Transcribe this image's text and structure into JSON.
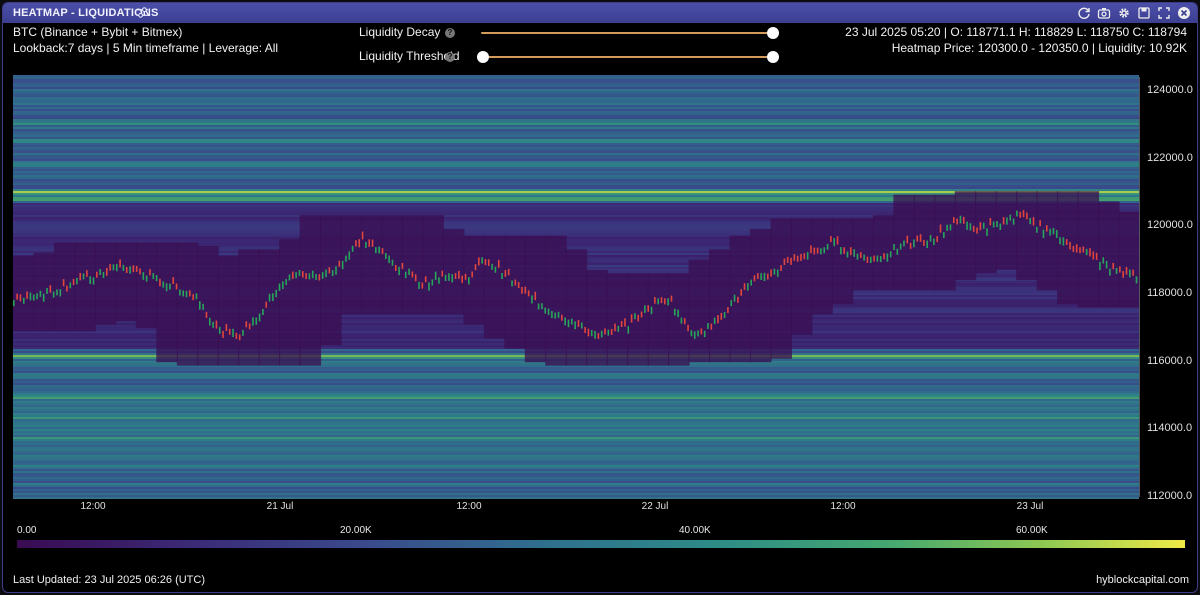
{
  "window": {
    "title": "HEATMAP - LIQUIDATIONS"
  },
  "colors": {
    "titlebar": "#3c3f91",
    "heat_low": "#3a0b53",
    "heat_high": "#f0ea47",
    "candle_up": "#26a65b",
    "candle_down": "#e0463c"
  },
  "toolbar_icons": [
    "refresh-icon",
    "camera-icon",
    "gear-icon",
    "save-icon",
    "expand-icon",
    "close-icon"
  ],
  "info": {
    "symbol": "BTC (Binance + Bybit + Bitmex)",
    "settings": "Lookback:7 days | 5 Min timeframe | Leverage: All",
    "ohlc": "23 Jul 2025 05:20 | O: 118771.1 H: 118829 L: 118750 C: 118794",
    "heatmap_price": "Heatmap Price: 120300.0 - 120350.0 | Liquidity: 10.92K"
  },
  "controls": {
    "decay": {
      "label": "Liquidity Decay",
      "value": 1.0
    },
    "threshold": {
      "label": "Liquidity Threshold",
      "min": 0.0,
      "max": 1.0
    }
  },
  "axes": {
    "x_ticks": [
      "12:00",
      "21 Jul",
      "12:00",
      "22 Jul",
      "12:00",
      "23 Jul"
    ],
    "y_ticks": [
      "124000.0",
      "122000.0",
      "120000.0",
      "118000.0",
      "116000.0",
      "114000.0",
      "112000.0"
    ]
  },
  "colorbar": {
    "labels": [
      "0.00",
      "20.00K",
      "40.00K",
      "60.00K"
    ]
  },
  "footer": {
    "updated": "Last Updated: 23 Jul 2025 06:26 (UTC)",
    "brand": "hyblockcapital.com"
  },
  "chart_data": {
    "type": "heatmap",
    "ylim": [
      112000,
      124400
    ],
    "price_series": [
      117800,
      118000,
      118100,
      118400,
      118500,
      118800,
      118700,
      118400,
      118200,
      117900,
      116900,
      116800,
      117400,
      118300,
      118600,
      118500,
      118900,
      119600,
      119200,
      118700,
      118300,
      118600,
      118400,
      119000,
      118600,
      118000,
      117600,
      117300,
      116900,
      116800,
      117100,
      117600,
      117900,
      116900,
      117000,
      117700,
      118300,
      118600,
      119000,
      119200,
      119500,
      119200,
      119000,
      119300,
      119500,
      119600,
      120200,
      119900,
      120000,
      120300,
      120000,
      119700,
      119300,
      119000,
      118600,
      118500
    ],
    "bands": [
      {
        "price": 123600,
        "intensity": 0.55
      },
      {
        "price": 123000,
        "intensity": 0.62
      },
      {
        "price": 122500,
        "intensity": 0.7
      },
      {
        "price": 121800,
        "intensity": 0.65
      },
      {
        "price": 121000,
        "intensity": 0.95
      },
      {
        "price": 120800,
        "intensity": 0.85
      },
      {
        "price": 116200,
        "intensity": 0.88
      },
      {
        "price": 115600,
        "intensity": 0.6
      },
      {
        "price": 115000,
        "intensity": 0.78
      },
      {
        "price": 114400,
        "intensity": 0.66
      },
      {
        "price": 113800,
        "intensity": 0.72
      },
      {
        "price": 113200,
        "intensity": 0.55
      }
    ]
  }
}
